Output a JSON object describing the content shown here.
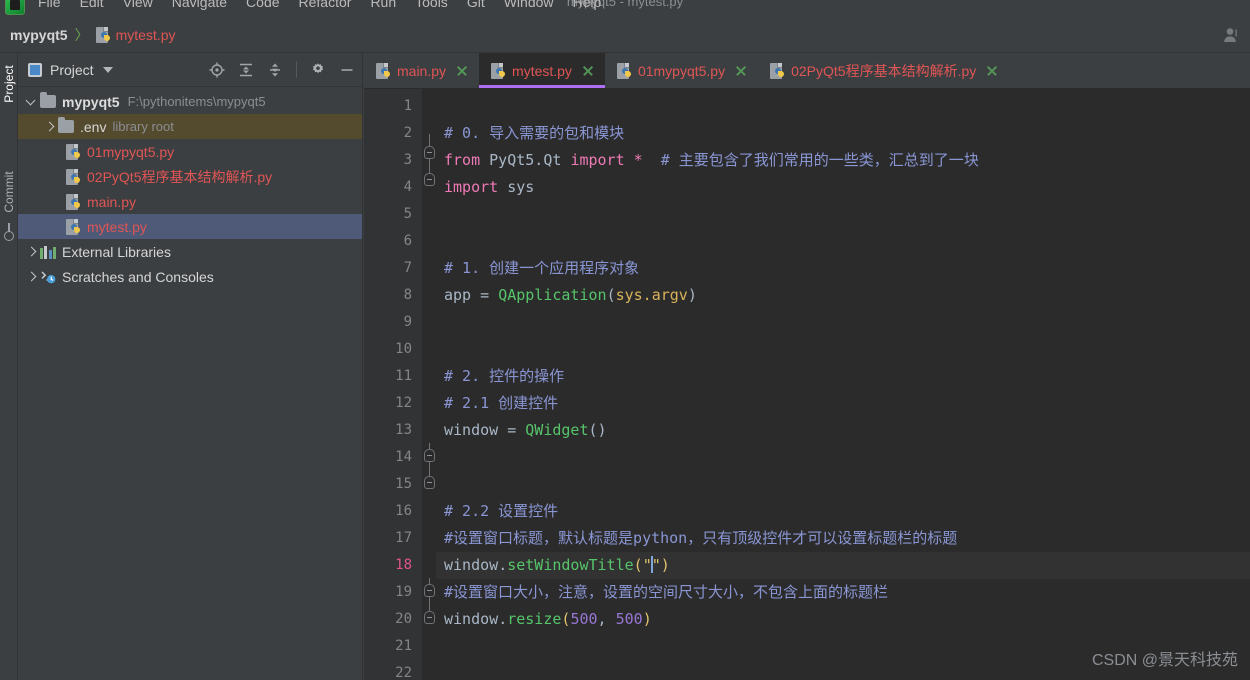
{
  "window": {
    "title": "mypyqt5 - mytest.py"
  },
  "menubar": {
    "items": [
      {
        "label": "File"
      },
      {
        "label": "Edit"
      },
      {
        "label": "View"
      },
      {
        "label": "Navigate"
      },
      {
        "label": "Code"
      },
      {
        "label": "Refactor"
      },
      {
        "label": "Run"
      },
      {
        "label": "Tools"
      },
      {
        "label": "Git"
      },
      {
        "label": "Window"
      },
      {
        "label": "Help"
      }
    ]
  },
  "breadcrumb": {
    "root": "mypyqt5",
    "separator": "〉",
    "file": "mytest.py",
    "file_icon": "python-file-icon",
    "account_icon": "user-account-icon"
  },
  "toolstrip": {
    "tabs": [
      {
        "label": "Project",
        "active": true
      },
      {
        "label": "Commit",
        "active": false
      }
    ]
  },
  "project_panel": {
    "title": "Project",
    "icons": {
      "view_icon": "project-view-icon",
      "dropdown": "chevron-down-icon",
      "locate": "locate-target-icon",
      "expand_all": "expand-all-icon",
      "collapse_all": "collapse-all-icon",
      "settings": "gear-icon",
      "hide": "minimize-icon"
    },
    "tree": [
      {
        "label": "mypyqt5",
        "path": "F:\\pythonitems\\mypyqt5",
        "type": "folder",
        "expanded": true,
        "indent": 0,
        "bold": true,
        "state": "normal"
      },
      {
        "label": ".env",
        "path": "library root",
        "type": "folder",
        "expanded": false,
        "indent": 1,
        "bold": false,
        "state": "highlight"
      },
      {
        "label": "01mypyqt5.py",
        "path": "",
        "type": "python",
        "indent": 2,
        "state": "modified"
      },
      {
        "label": "02PyQt5程序基本结构解析.py",
        "path": "",
        "type": "python",
        "indent": 2,
        "state": "modified"
      },
      {
        "label": "main.py",
        "path": "",
        "type": "python",
        "indent": 2,
        "state": "modified"
      },
      {
        "label": "mytest.py",
        "path": "",
        "type": "python",
        "indent": 2,
        "state": "selected"
      },
      {
        "label": "External Libraries",
        "path": "",
        "type": "libraries",
        "expanded": false,
        "indent": 0,
        "state": "normal"
      },
      {
        "label": "Scratches and Consoles",
        "path": "",
        "type": "scratches",
        "expanded": false,
        "indent": 0,
        "state": "normal"
      }
    ]
  },
  "editor": {
    "tabs": [
      {
        "label": "main.py",
        "active": false
      },
      {
        "label": "mytest.py",
        "active": true
      },
      {
        "label": "01mypyqt5.py",
        "active": false
      },
      {
        "label": "02PyQt5程序基本结构解析.py",
        "active": false
      }
    ],
    "close_icon": "close-tab-icon",
    "current_line": 18,
    "first_line": 1,
    "lines": [
      {
        "n": 1,
        "text": ""
      },
      {
        "n": 2,
        "text": "# 0. 导入需要的包和模块"
      },
      {
        "n": 3,
        "text": "from PyQt5.Qt import *  # 主要包含了我们常用的一些类，汇总到了一块"
      },
      {
        "n": 4,
        "text": "import sys"
      },
      {
        "n": 5,
        "text": ""
      },
      {
        "n": 6,
        "text": ""
      },
      {
        "n": 7,
        "text": "# 1. 创建一个应用程序对象"
      },
      {
        "n": 8,
        "text": "app = QApplication(sys.argv)"
      },
      {
        "n": 9,
        "text": ""
      },
      {
        "n": 10,
        "text": ""
      },
      {
        "n": 11,
        "text": "# 2. 控件的操作"
      },
      {
        "n": 12,
        "text": "# 2.1 创建控件"
      },
      {
        "n": 13,
        "text": "window = QWidget()"
      },
      {
        "n": 14,
        "text": ""
      },
      {
        "n": 15,
        "text": ""
      },
      {
        "n": 16,
        "text": "# 2.2 设置控件"
      },
      {
        "n": 17,
        "text": "#设置窗口标题，默认标题是python，只有顶级控件才可以设置标题栏的标题"
      },
      {
        "n": 18,
        "text": "window.setWindowTitle(\"\")"
      },
      {
        "n": 19,
        "text": "#设置窗口大小，注意，设置的空间尺寸大小，不包含上面的标题栏"
      },
      {
        "n": 20,
        "text": "window.resize(500, 500)"
      },
      {
        "n": 21,
        "text": ""
      },
      {
        "n": 22,
        "text": ""
      }
    ]
  },
  "watermark": {
    "text": "CSDN @景天科技苑"
  },
  "colors": {
    "accent_tab": "#b06ef2",
    "file_modified": "#e05555",
    "selection": "#4f5a78",
    "env_highlight": "#544a2e",
    "editor_bg": "#2b2b2b",
    "panel_bg": "#3c3f41",
    "gutter_bg": "#313335",
    "current_line_number": "#e0558c",
    "comment": "#8a96d4",
    "keyword": "#ee7ab5",
    "function": "#56c46a",
    "number": "#9876d3",
    "string": "#e0c46c"
  }
}
